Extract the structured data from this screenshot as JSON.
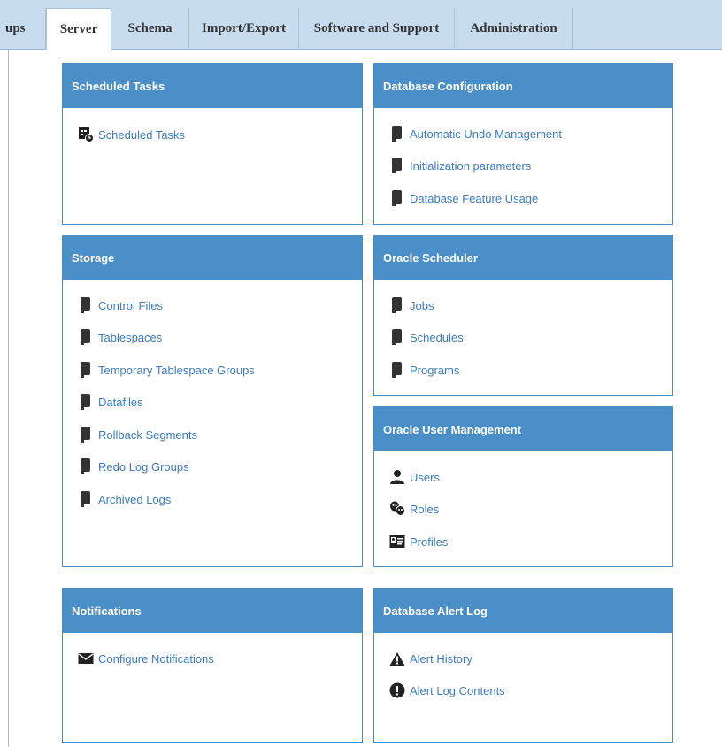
{
  "tabs": [
    {
      "label": "ups",
      "active": false
    },
    {
      "label": "Server",
      "active": true
    },
    {
      "label": "Schema",
      "active": false
    },
    {
      "label": "Import/Export",
      "active": false
    },
    {
      "label": "Software and Support",
      "active": false
    },
    {
      "label": "Administration",
      "active": false
    }
  ],
  "panels": {
    "scheduled_tasks": {
      "title": "Scheduled Tasks",
      "links": [
        {
          "label": "Scheduled Tasks",
          "icon": "scheduled-tasks-icon"
        }
      ]
    },
    "database_configuration": {
      "title": "Database Configuration",
      "links": [
        {
          "label": "Automatic Undo Management",
          "icon": "database-item-icon"
        },
        {
          "label": "Initialization parameters",
          "icon": "database-item-icon"
        },
        {
          "label": "Database Feature Usage",
          "icon": "database-item-icon"
        }
      ]
    },
    "storage": {
      "title": "Storage",
      "links": [
        {
          "label": "Control Files",
          "icon": "database-item-icon"
        },
        {
          "label": "Tablespaces",
          "icon": "database-item-icon"
        },
        {
          "label": "Temporary Tablespace Groups",
          "icon": "database-item-icon"
        },
        {
          "label": "Datafiles",
          "icon": "database-item-icon"
        },
        {
          "label": "Rollback Segments",
          "icon": "database-item-icon"
        },
        {
          "label": "Redo Log Groups",
          "icon": "database-item-icon"
        },
        {
          "label": "Archived Logs",
          "icon": "database-item-icon"
        }
      ]
    },
    "oracle_scheduler": {
      "title": "Oracle Scheduler",
      "links": [
        {
          "label": "Jobs",
          "icon": "database-item-icon"
        },
        {
          "label": "Schedules",
          "icon": "database-item-icon"
        },
        {
          "label": "Programs",
          "icon": "database-item-icon"
        }
      ]
    },
    "oracle_user_management": {
      "title": "Oracle User Management",
      "links": [
        {
          "label": "Users",
          "icon": "user-icon"
        },
        {
          "label": "Roles",
          "icon": "roles-icon"
        },
        {
          "label": "Profiles",
          "icon": "profile-card-icon"
        }
      ]
    },
    "notifications": {
      "title": "Notifications",
      "links": [
        {
          "label": "Configure Notifications",
          "icon": "envelope-icon"
        }
      ]
    },
    "database_alert_log": {
      "title": "Database Alert Log",
      "links": [
        {
          "label": "Alert History",
          "icon": "warning-triangle-icon"
        },
        {
          "label": "Alert Log Contents",
          "icon": "exclamation-circle-icon"
        }
      ]
    }
  },
  "colors": {
    "header_blue": "#4a8fc8",
    "link_blue": "#3c7bbf",
    "tabbar": "#c7dcee"
  }
}
